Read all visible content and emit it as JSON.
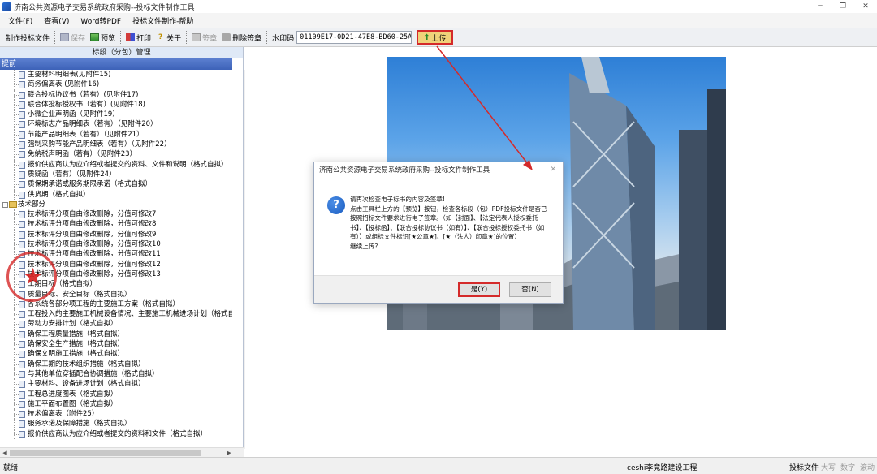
{
  "window": {
    "title": "济南公共资源电子交易系统政府采购--投标文件制作工具"
  },
  "menu": [
    "文件(F)",
    "查看(V)",
    "Word转PDF",
    "投标文件制作-帮助"
  ],
  "toolbar": {
    "make_bid": "制作投标文件",
    "save": "保存",
    "preview": "预览",
    "print": "打印",
    "about": "关于",
    "sign": "签章",
    "delete_sign": "删除签章",
    "watermark_label": "水印码",
    "watermark_value": "01109E17-0D21-47E8-BD60-25A5",
    "upload": "上传"
  },
  "left_panel": {
    "header": "标段（分包）管理",
    "selected_node": "提前",
    "items_before": [
      "主要材料明细表(见附件15)",
      "商务偏离表 (见附件16)",
      "联合投标协议书（若有）(见附件17)",
      "联合体投标授权书（若有）(见附件18)",
      "小微企业声明函（见附件19）",
      "环境标志产品明细表（若有）（见附件20）",
      "节能产品明细表（若有）（见附件21）",
      "强制采购节能产品明细表（若有）（见附件22）",
      "免纳税声明函（若有）（见附件23）",
      "报价供应商认为应介绍或者提交的资料、文件和说明（格式自拟）",
      "质疑函（若有）（见附件24）",
      "质保期承诺或服务期限承诺（格式自拟）",
      "供货期（格式自拟）"
    ],
    "folder": "技术部分",
    "items_after": [
      "技术标评分项自由修改删除，分值可修改7",
      "技术标评分项自由修改删除，分值可修改8",
      "技术标评分项自由修改删除，分值可修改9",
      "技术标评分项自由修改删除，分值可修改10",
      "技术标评分项自由修改删除，分值可修改11",
      "技术标评分项自由修改删除，分值可修改12",
      "技术标评分项自由修改删除，分值可修改13",
      "工期目标（格式自拟）",
      "质量目标、安全目标（格式自拟）",
      "各系统各部分项工程的主要施工方案（格式自拟）",
      "工程投入的主要施工机械设备情况、主要施工机械进场计划（格式自拟）",
      "劳动力安排计划（格式自拟）",
      "确保工程质量措施（格式自拟）",
      "确保安全生产措施（格式自拟）",
      "确保文明施工措施（格式自拟）",
      "确保工期的技术组织措施（格式自拟）",
      "与其他单位穿插配合协调措施（格式自拟）",
      "主要材料、设备进场计划（格式自拟）",
      "工程总进度图表（格式自拟）",
      "施工平面布置图（格式自拟）",
      "技术偏离表（附件25）",
      "服务承诺及保障措施（格式自拟）",
      "报价供应商认为应介绍或者提交的资料和文件（格式自拟）"
    ]
  },
  "dialog": {
    "title": "济南公共资源电子交易系统政府采购--投标文件制作工具",
    "line1": "请再次检查电子标书的内容及签章!",
    "line2": "点击工具栏上方的【预览】按钮，检查各标段（包）PDF投标文件是否已按照招标文件要求进行电子签章。（如【封面】、【法定代表人授权委托书】、【投标函】、【联合投标协议书（如有）】、【联合投标授权委托书（如有）】或组标文件标识[★公章★]、[★（法人）印章★]的位置）",
    "line3": "继续上传?",
    "yes": "是(Y)",
    "no": "否(N)"
  },
  "statusbar": {
    "left": "就绪",
    "company": "ceshi李竟路建设工程",
    "mode": "投标文件",
    "caps": "大写",
    "num": "数字",
    "scroll": "滚动"
  },
  "colors": {
    "highlight_red": "#d42a2a",
    "node_blue": "#3d62b8",
    "upload_bg": "#f0d27a"
  }
}
